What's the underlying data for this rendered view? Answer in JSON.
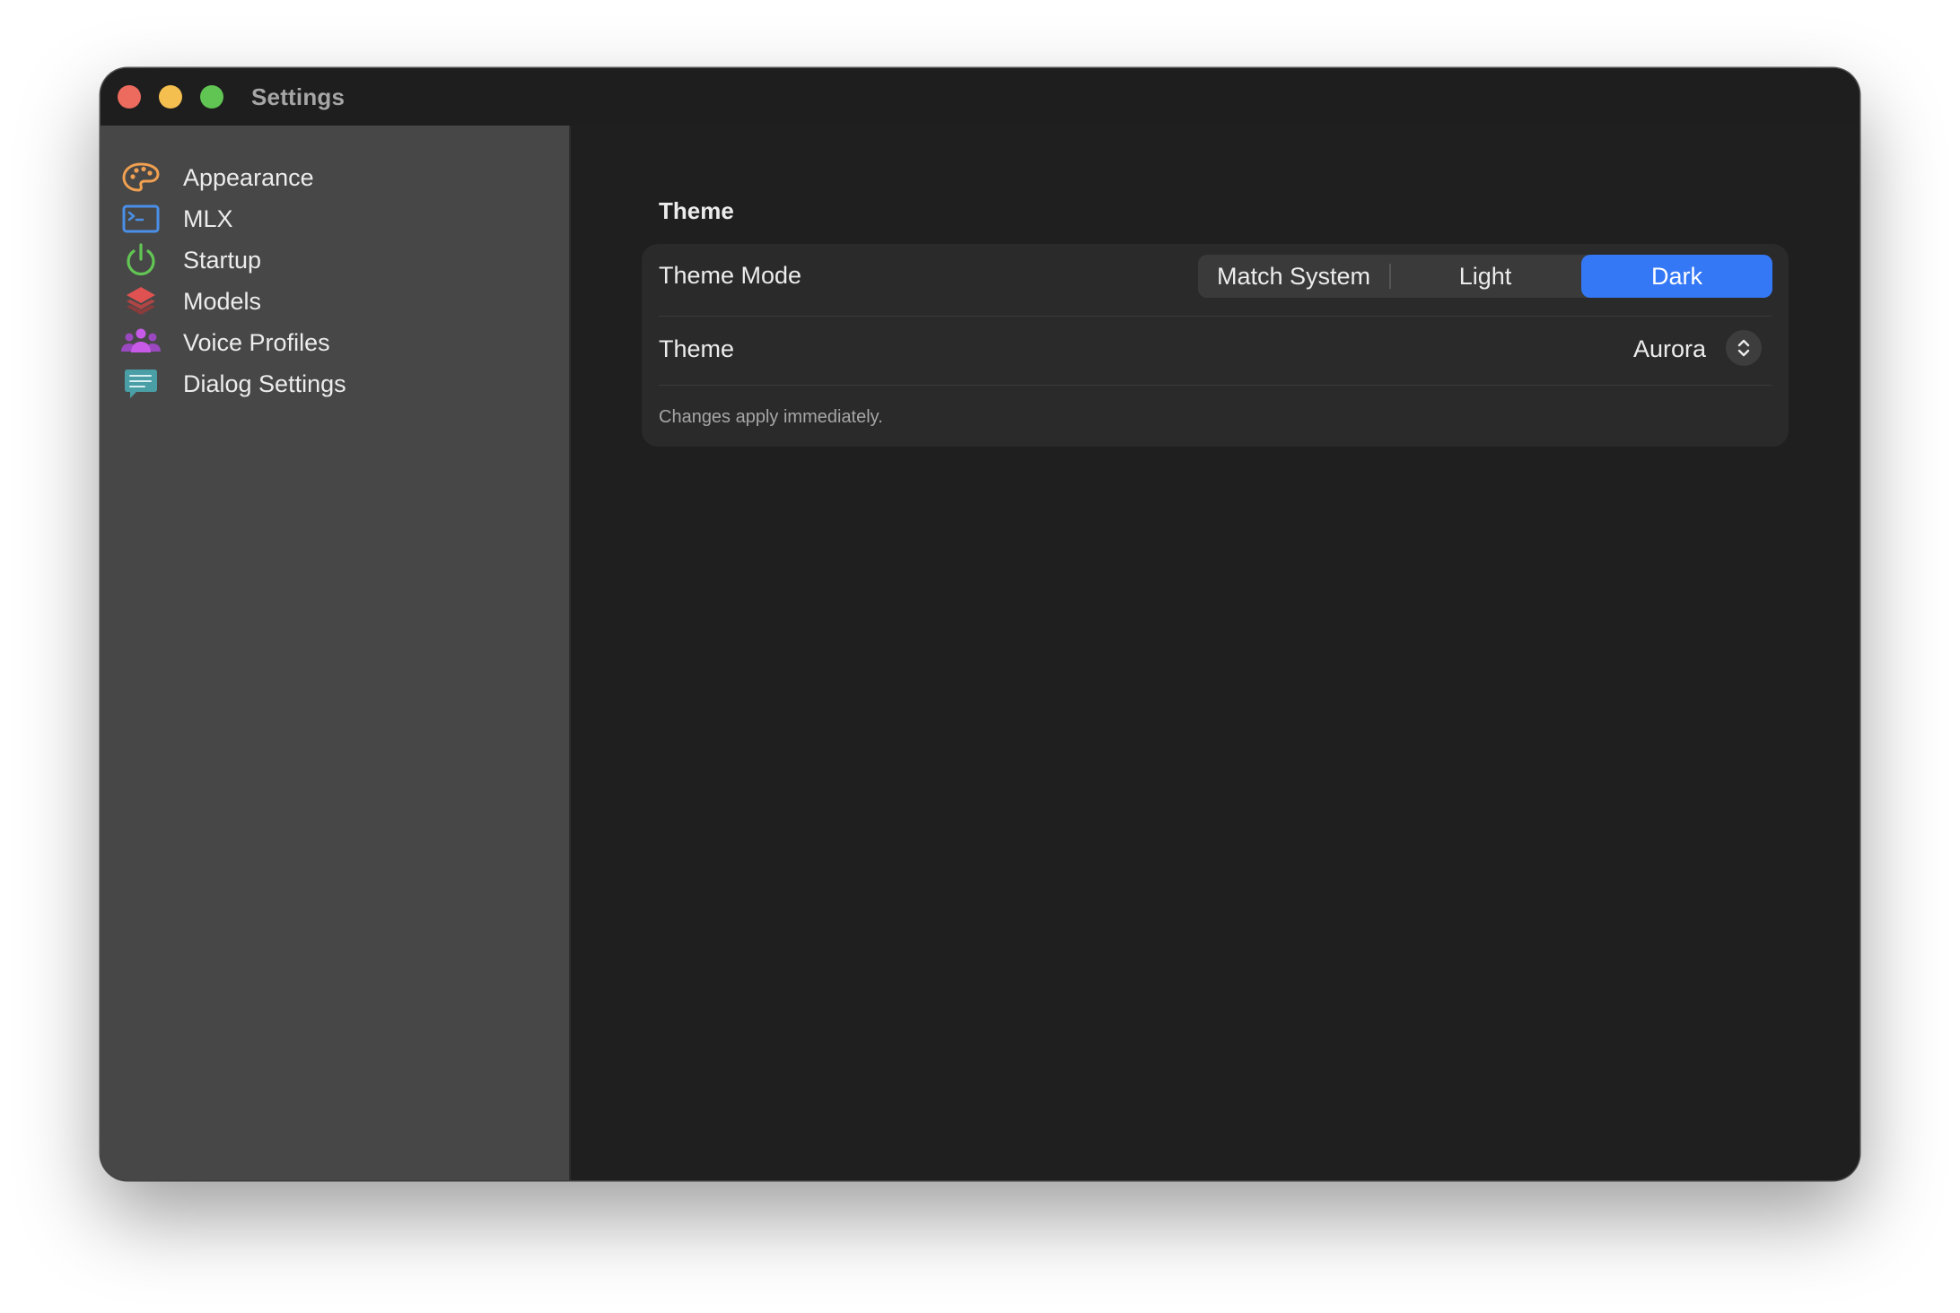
{
  "window": {
    "title": "Settings"
  },
  "sidebar": {
    "items": [
      {
        "label": "Appearance",
        "icon": "palette-icon",
        "color": "#f0a050"
      },
      {
        "label": "MLX",
        "icon": "terminal-icon",
        "color": "#4a8fe7"
      },
      {
        "label": "Startup",
        "icon": "power-icon",
        "color": "#62c554"
      },
      {
        "label": "Models",
        "icon": "stack-icon",
        "color": "#e05252"
      },
      {
        "label": "Voice Profiles",
        "icon": "people-icon",
        "color": "#b04fd6"
      },
      {
        "label": "Dialog Settings",
        "icon": "chat-bubble-icon",
        "color": "#4a9ea6"
      }
    ]
  },
  "main": {
    "section_title": "Theme",
    "theme_mode": {
      "label": "Theme Mode",
      "options": [
        "Match System",
        "Light",
        "Dark"
      ],
      "selected": "Dark"
    },
    "theme": {
      "label": "Theme",
      "value": "Aurora"
    },
    "note": "Changes apply immediately."
  },
  "colors": {
    "accent": "#3478f6",
    "sidebar_bg": "#474747",
    "content_bg": "#1f1f1f",
    "group_bg": "#2a2a2a"
  }
}
